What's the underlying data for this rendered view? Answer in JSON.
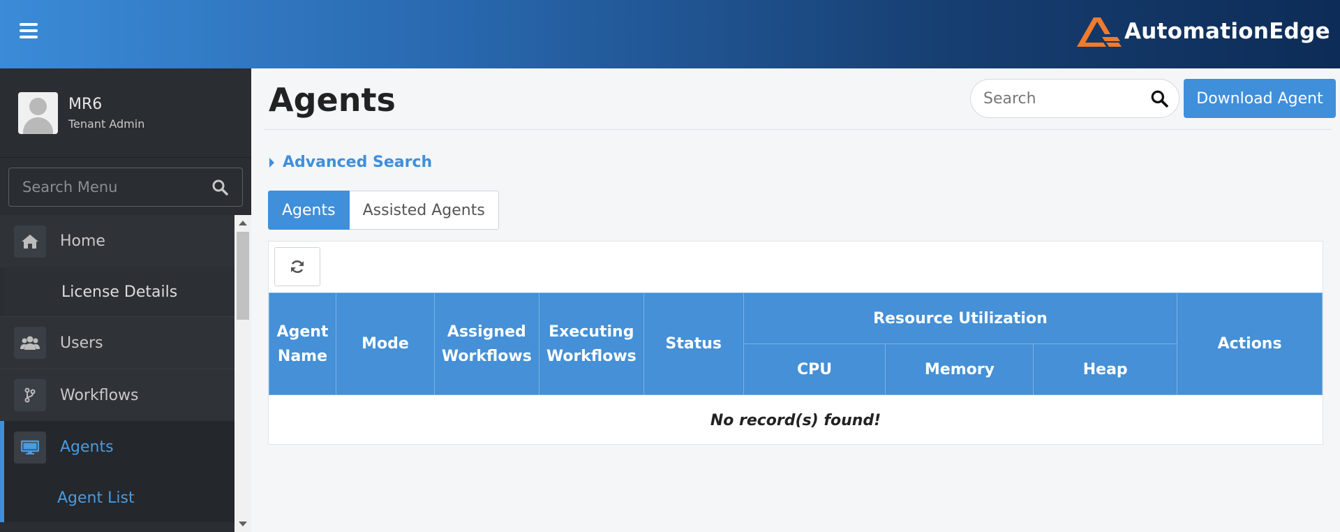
{
  "brand": {
    "name": "AutomationEdge",
    "accent": "#3f8fdb",
    "logo_color": "#f07b2d"
  },
  "user": {
    "name": "MR6",
    "role": "Tenant Admin"
  },
  "sidebar": {
    "search_placeholder": "Search Menu",
    "items": [
      {
        "label": "Home",
        "icon": "home-icon"
      },
      {
        "label": "License Details",
        "icon": null
      },
      {
        "label": "Users",
        "icon": "users-icon"
      },
      {
        "label": "Workflows",
        "icon": "branch-icon"
      },
      {
        "label": "Agents",
        "icon": "monitor-icon",
        "active": true
      },
      {
        "label": "Agent List",
        "icon": null,
        "active": true
      }
    ]
  },
  "page": {
    "title": "Agents",
    "search_placeholder": "Search",
    "download_label": "Download Agent",
    "advanced_search_label": "Advanced Search"
  },
  "tabs": [
    {
      "label": "Agents",
      "active": true
    },
    {
      "label": "Assisted Agents",
      "active": false
    }
  ],
  "table": {
    "columns": {
      "agent_name": "Agent Name",
      "mode": "Mode",
      "assigned": "Assigned Workflows",
      "executing": "Executing Workflows",
      "status": "Status",
      "resource_group": "Resource Utilization",
      "cpu": "CPU",
      "memory": "Memory",
      "heap": "Heap",
      "actions": "Actions"
    },
    "empty_message": "No record(s) found!"
  }
}
